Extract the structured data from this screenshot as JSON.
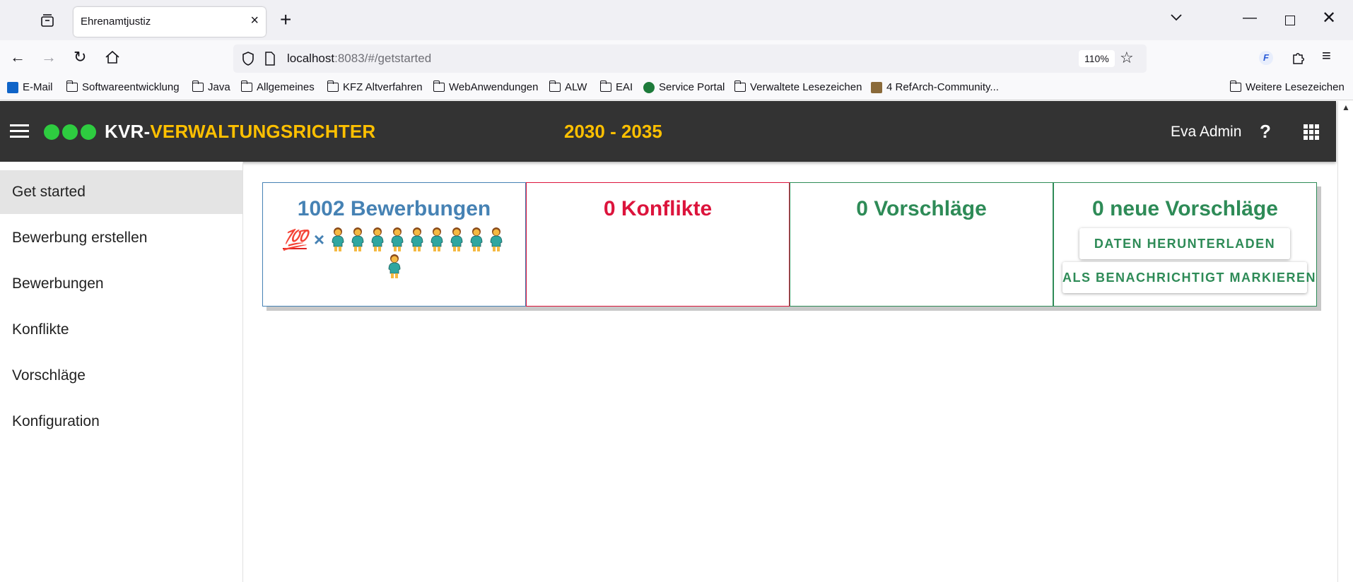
{
  "browser": {
    "tab_title": "Ehrenamtjustiz",
    "url_host": "localhost",
    "url_rest": ":8083/#/getstarted",
    "zoom": "110%",
    "bookmarks": [
      "E-Mail",
      "Softwareentwicklung",
      "Java",
      "Allgemeines",
      "KFZ Altverfahren",
      "WebAnwendungen",
      "ALW",
      "EAI",
      "Service Portal",
      "Verwaltete Lesezeichen",
      "4 RefArch-Community...",
      "Weitere Lesezeichen"
    ]
  },
  "app": {
    "brand_prefix": "KVR-",
    "brand_accent": "VERWALTUNGSRICHTER",
    "period": "2030 - 2035",
    "user": "Eva Admin",
    "help": "?",
    "brand_dot_color": "#2ecc40",
    "accent_color": "#fec000",
    "header_bg": "#333333"
  },
  "sidebar": {
    "items": [
      "Get started",
      "Bewerbung erstellen",
      "Bewerbungen",
      "Konflikte",
      "Vorschläge",
      "Konfiguration"
    ],
    "active": "Get started"
  },
  "stats": {
    "bewerbungen": {
      "title": "1002 Bewerbungen",
      "hundred": "💯",
      "times": "×",
      "person_icons": 10,
      "color": "#4682b4"
    },
    "konflikte": {
      "title": "0 Konflikte",
      "color": "#dc143c"
    },
    "vorschlaege": {
      "title": "0 Vorschläge",
      "color": "#2e8b57"
    },
    "neue_vorschlaege": {
      "title": "0 neue Vorschläge",
      "color": "#2e8b57",
      "download_label": "DATEN HERUNTERLADEN",
      "mark_label": "ALS BENACHRICHTIGT MARKIEREN"
    }
  }
}
